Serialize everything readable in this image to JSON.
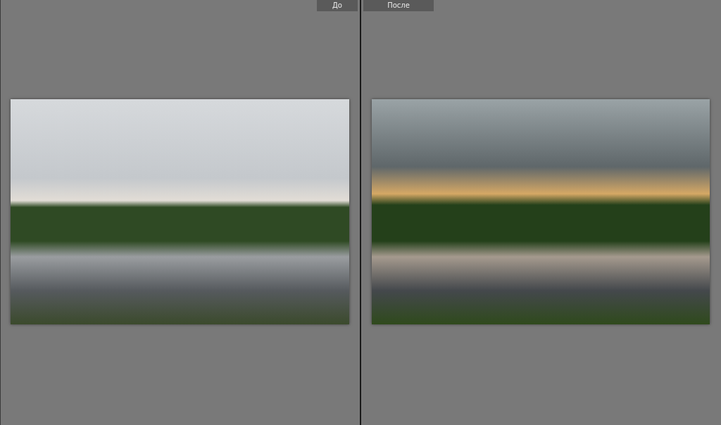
{
  "panes": [
    {
      "label": "До",
      "kind": "before"
    },
    {
      "label": "После",
      "kind": "after"
    }
  ]
}
